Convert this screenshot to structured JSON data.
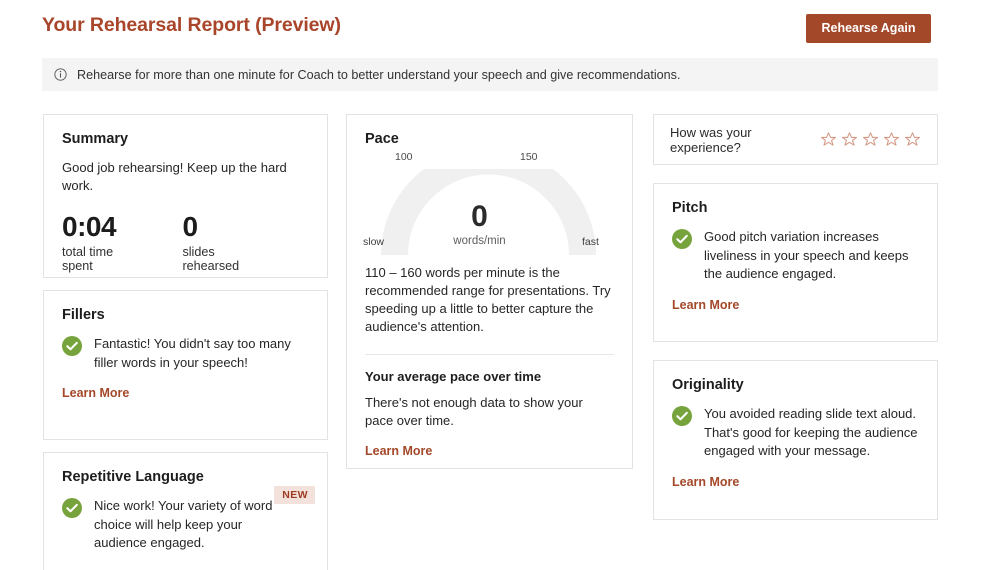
{
  "header": {
    "title": "Your Rehearsal Report (Preview)",
    "rehearse_button": "Rehearse Again",
    "accent_color": "#A4482A"
  },
  "info_bar": {
    "icon": "info-circle-icon",
    "text": "Rehearse for more than one minute for Coach to better understand your speech and give recommendations."
  },
  "summary": {
    "title": "Summary",
    "description": "Good job rehearsing! Keep up the hard work.",
    "stats": [
      {
        "value": "0:04",
        "label": "total time spent"
      },
      {
        "value": "0",
        "label": "slides rehearsed"
      }
    ]
  },
  "fillers": {
    "title": "Fillers",
    "icon": "check-circle-icon",
    "tip": "Fantastic! You didn't say too many filler words in your speech!",
    "learn_more": "Learn More"
  },
  "repetitive": {
    "title": "Repetitive Language",
    "badge": "NEW",
    "icon": "check-circle-icon",
    "tip": "Nice work! Your variety of word choice will help keep your audience engaged."
  },
  "pace": {
    "title": "Pace",
    "gauge": {
      "value": "0",
      "units": "words/min",
      "tick_low": "100",
      "tick_high": "150",
      "end_low": "slow",
      "end_high": "fast",
      "track_color": "#F0F0F0"
    },
    "description": "110 – 160 words per minute is the recommended range for presentations. Try speeding up a little to better capture the audience's attention.",
    "over_time_title": "Your average pace over time",
    "over_time_text": "There's not enough data to show your pace over time.",
    "learn_more": "Learn More"
  },
  "experience": {
    "label": "How was your experience?",
    "star_count": 5,
    "stars_filled": 0,
    "star_color": "#D49A85",
    "icon": "star-outline-icon"
  },
  "pitch": {
    "title": "Pitch",
    "icon": "check-circle-icon",
    "tip": "Good pitch variation increases liveliness in your speech and keeps the audience engaged.",
    "learn_more": "Learn More"
  },
  "originality": {
    "title": "Originality",
    "icon": "check-circle-icon",
    "tip": "You avoided reading slide text aloud. That's good for keeping the audience engaged with your message.",
    "learn_more": "Learn More"
  },
  "chart_data": {
    "type": "gauge",
    "title": "Pace",
    "value": 0,
    "units": "words/min",
    "min": 0,
    "max": 250,
    "tick_labels": [
      "100",
      "150"
    ],
    "endpoint_labels": [
      "slow",
      "fast"
    ],
    "recommended_range": [
      110,
      160
    ],
    "grid": false,
    "legend": "none",
    "note": "There's not enough data to show your pace over time."
  }
}
